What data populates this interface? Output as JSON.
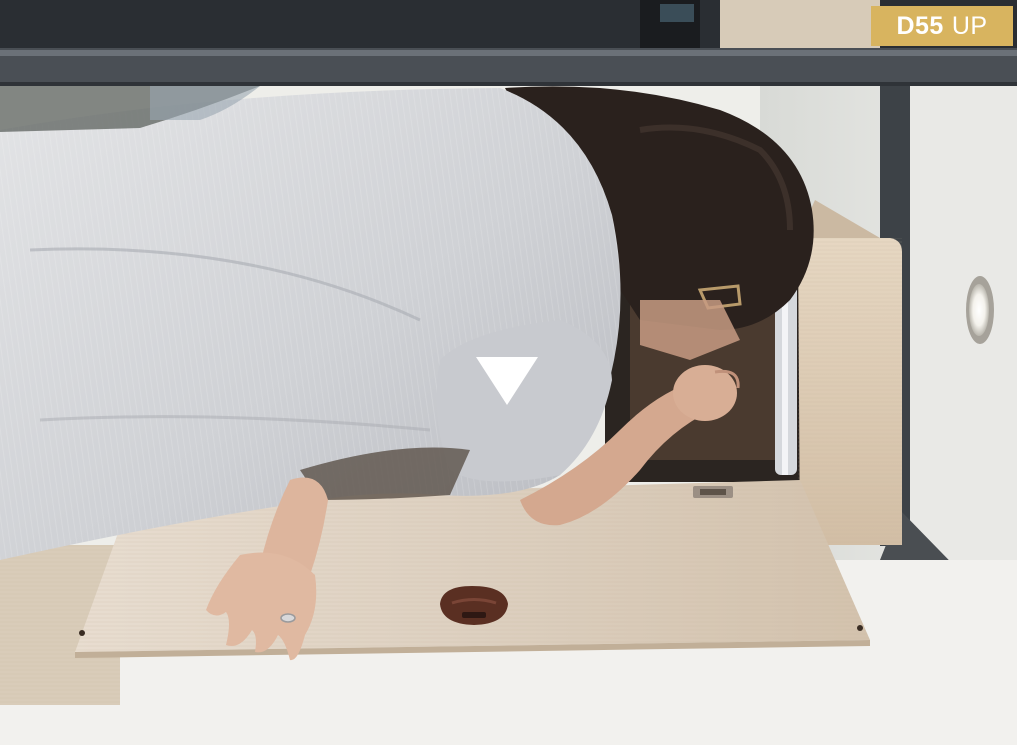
{
  "badge": {
    "model": "D55",
    "suffix": "UP"
  },
  "controls": {
    "play_icon": "play-triangle-down-icon"
  },
  "colors": {
    "badge_bg": "#d8b45f",
    "panel": "#dccfbd",
    "shirt": "#c9cbcf",
    "hair": "#2a211d"
  }
}
